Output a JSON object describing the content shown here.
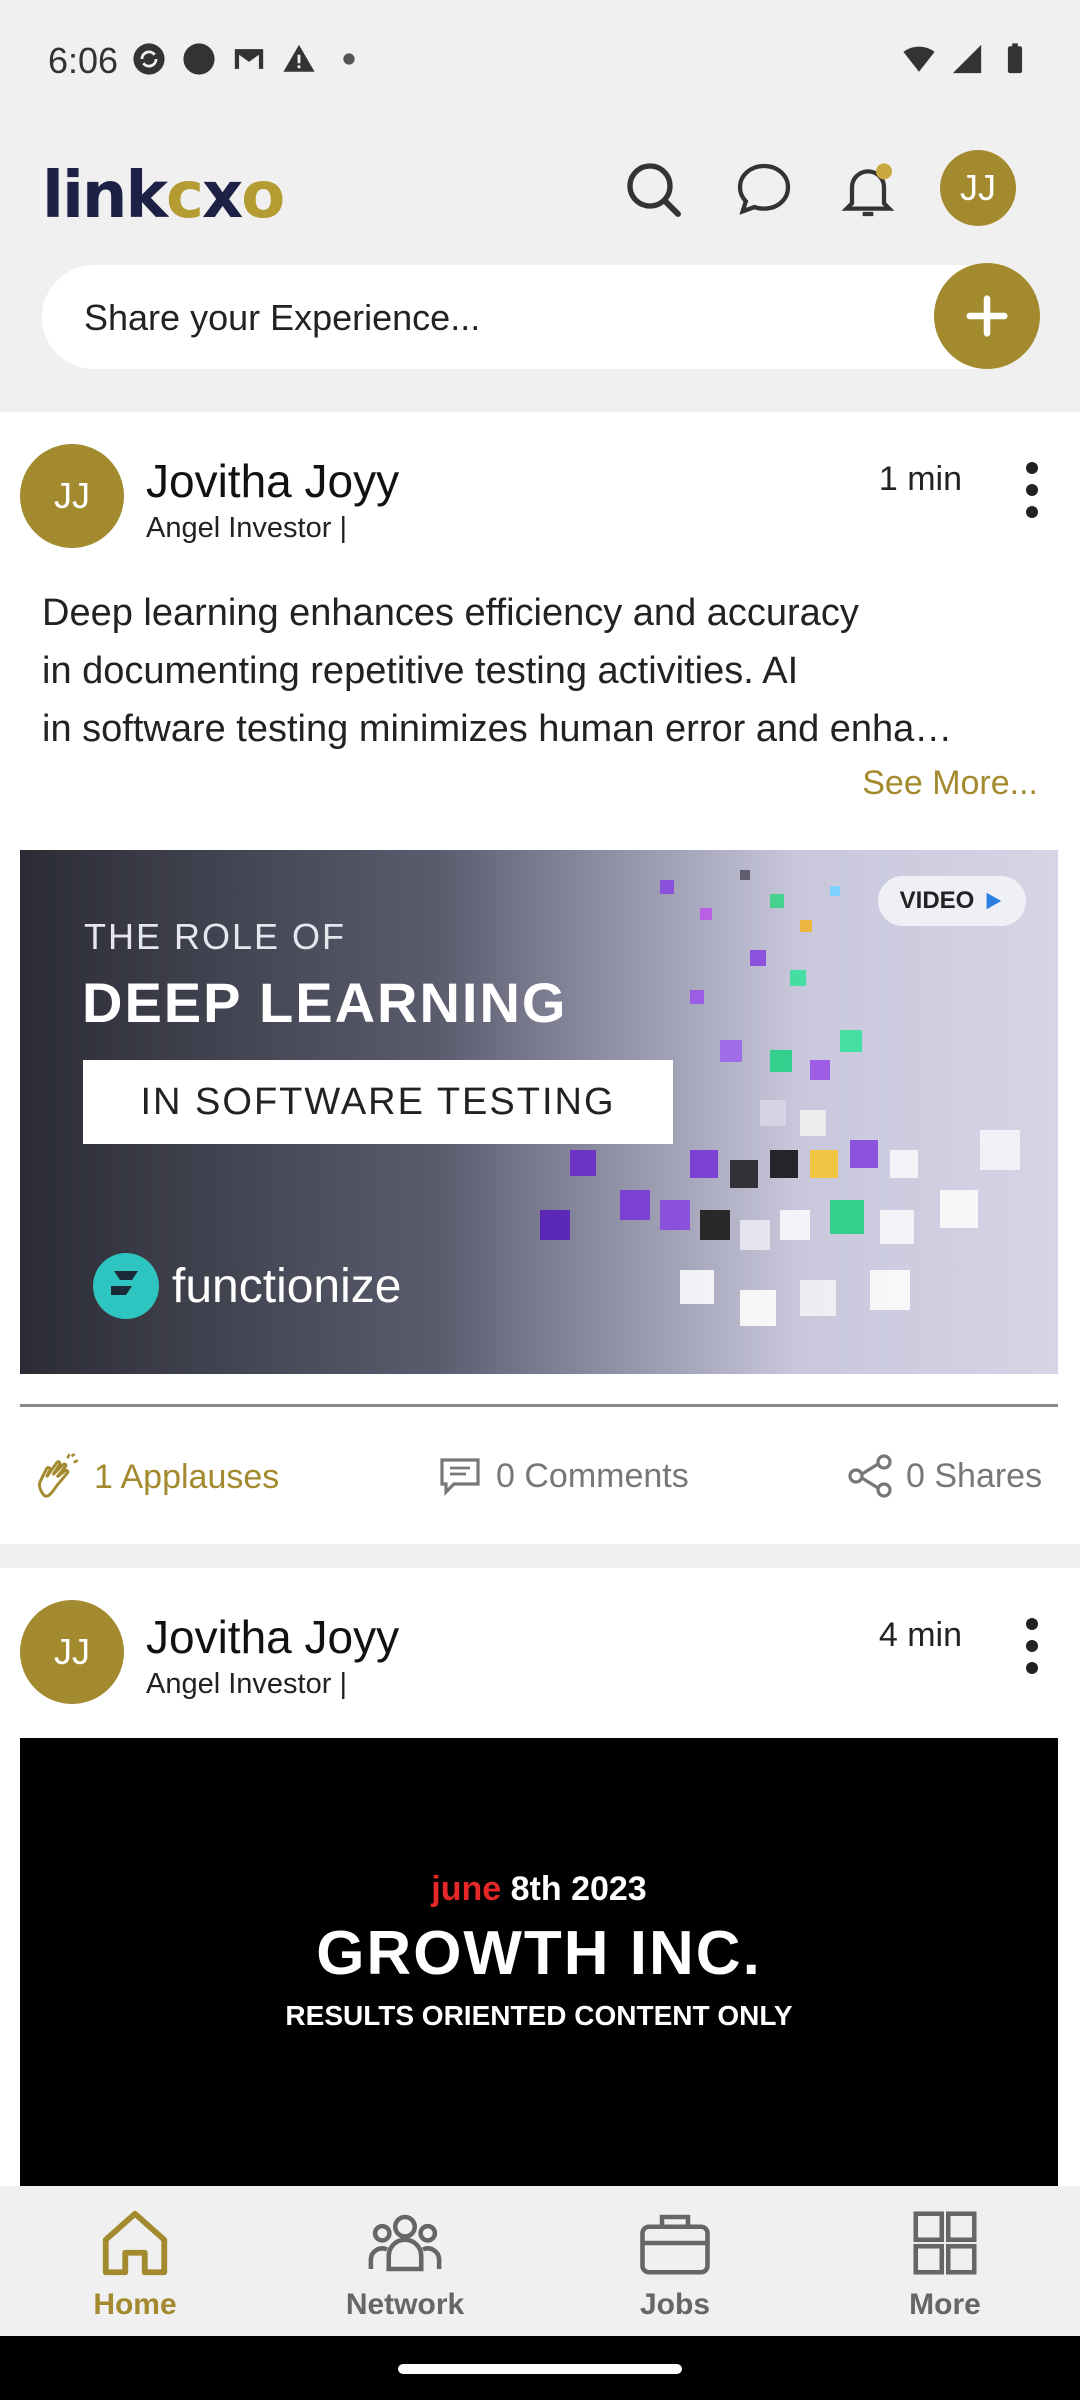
{
  "status_bar": {
    "time": "6:06"
  },
  "header": {
    "logo_text_dark_1": "link",
    "logo_text_gold": "c",
    "logo_text_dark_2": "x",
    "logo_text_gold_2": "o",
    "user_initials": "JJ"
  },
  "composer": {
    "placeholder": "Share your Experience..."
  },
  "posts": [
    {
      "initials": "JJ",
      "author": "Jovitha Joyy",
      "role": "Angel Investor |",
      "time": "1 min",
      "text_lines": [
        "Deep learning enhances efficiency and accuracy",
        "in documenting repetitive testing activities. AI",
        "in software testing minimizes human error and enha…"
      ],
      "see_more": "See More...",
      "media": {
        "line1": "THE ROLE OF",
        "line2": "DEEP LEARNING",
        "line3": "IN SOFTWARE TESTING",
        "badge": "VIDEO",
        "brand": "functionize"
      },
      "applauses": "1 Applauses",
      "comments": "0 Comments",
      "shares": "0 Shares"
    },
    {
      "initials": "JJ",
      "author": "Jovitha Joyy",
      "role": "Angel Investor |",
      "time": "4 min",
      "media": {
        "date_red": "june",
        "date_white": " 8th 2023",
        "title": "GROWTH INC.",
        "subtitle": "RESULTS ORIENTED CONTENT ONLY"
      }
    }
  ],
  "bottom_nav": [
    {
      "label": "Home",
      "active": true
    },
    {
      "label": "Network"
    },
    {
      "label": "Jobs"
    },
    {
      "label": "More"
    }
  ],
  "colors": {
    "accent": "#a38a2f",
    "navy": "#1e2146"
  }
}
